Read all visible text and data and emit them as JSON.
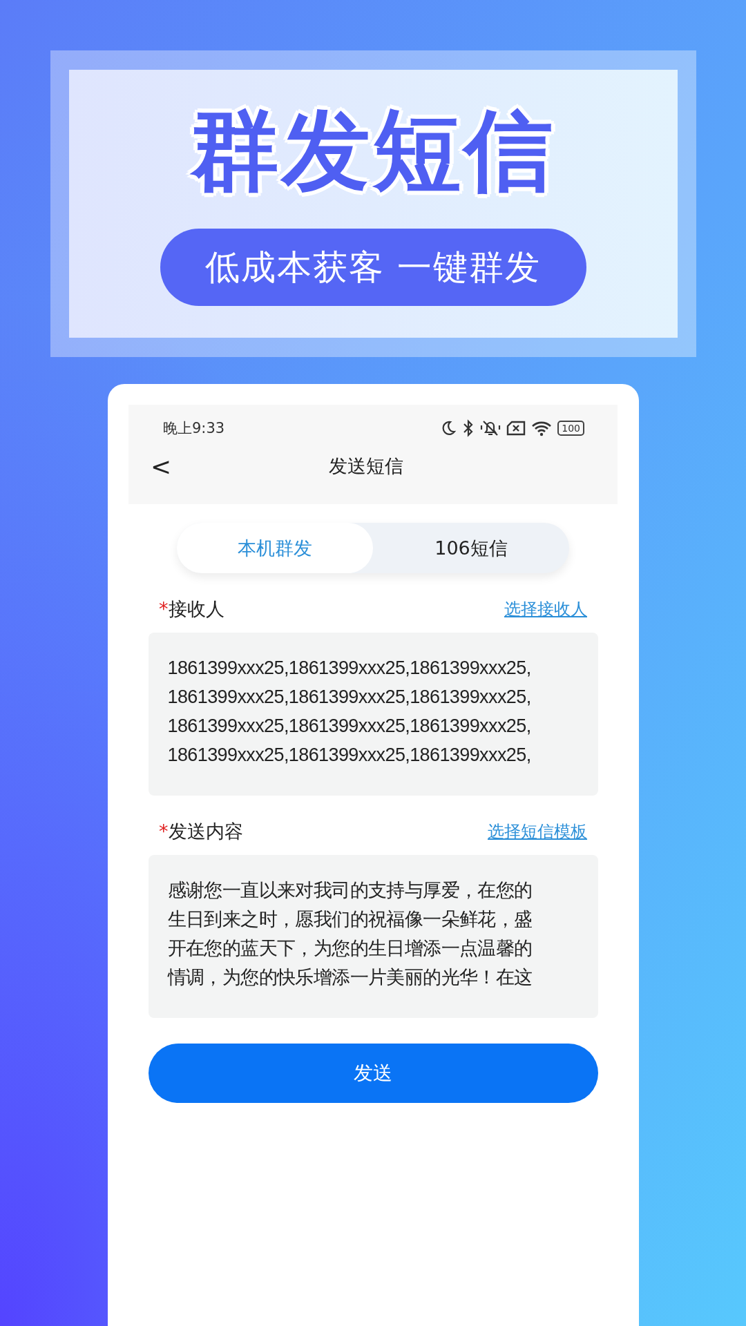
{
  "banner": {
    "title": "群发短信",
    "slogan": "低成本获客 一键群发"
  },
  "status_bar": {
    "time": "晚上9:33",
    "battery": "100"
  },
  "nav": {
    "back": "<",
    "title": "发送短信"
  },
  "tabs": [
    {
      "label": "本机群发",
      "selected": true
    },
    {
      "label": "106短信",
      "selected": false
    }
  ],
  "recipients": {
    "required_mark": "*",
    "label": "接收人",
    "link": "选择接收人",
    "lines": [
      "1861399xxx25,1861399xxx25,1861399xxx25,",
      "1861399xxx25,1861399xxx25,1861399xxx25,",
      "1861399xxx25,1861399xxx25,1861399xxx25,",
      "1861399xxx25,1861399xxx25,1861399xxx25,"
    ]
  },
  "content": {
    "required_mark": "*",
    "label": "发送内容",
    "link": "选择短信模板",
    "lines": [
      "感谢您一直以来对我司的支持与厚爱，在您的",
      "生日到来之时，愿我们的祝福像一朵鲜花，盛",
      "开在您的蓝天下，为您的生日增添一点温馨的",
      "情调，为您的快乐增添一片美丽的光华！在这"
    ]
  },
  "send_button": "发送"
}
